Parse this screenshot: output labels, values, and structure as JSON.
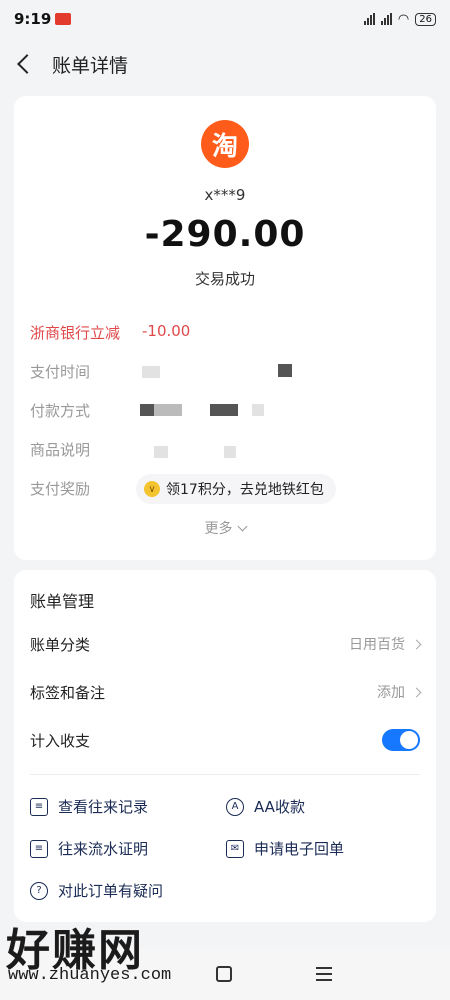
{
  "status_bar": {
    "time": "9:19",
    "battery": "26"
  },
  "nav": {
    "title": "账单详情"
  },
  "summary": {
    "merchant_logo_char": "淘",
    "merchant_name": "x***9",
    "amount": "-290.00",
    "status": "交易成功",
    "discount_label": "浙商银行立减",
    "discount_value": "-10.00",
    "pay_time_label": "支付时间",
    "pay_method_label": "付款方式",
    "goods_label": "商品说明",
    "reward_label": "支付奖励",
    "points_pill": "领17积分，去兑地铁红包",
    "more": "更多"
  },
  "manage": {
    "title": "账单管理",
    "category_label": "账单分类",
    "category_value": "日用百货",
    "tag_label": "标签和备注",
    "tag_value": "添加",
    "count_label": "计入收支",
    "count_enabled": true,
    "actions": [
      {
        "label": "查看往来记录",
        "icon": "records-icon"
      },
      {
        "label": "AA收款",
        "icon": "aa-icon"
      },
      {
        "label": "往来流水证明",
        "icon": "statement-icon"
      },
      {
        "label": "申请电子回单",
        "icon": "mail-icon"
      },
      {
        "label": "对此订单有疑问",
        "icon": "question-icon"
      }
    ]
  },
  "watermark": {
    "text": "好赚网",
    "url": "www.zhuanyes.com"
  },
  "colors": {
    "accent": "#1677ff",
    "discount": "#e0484a",
    "logo": "#ff5b1a"
  }
}
